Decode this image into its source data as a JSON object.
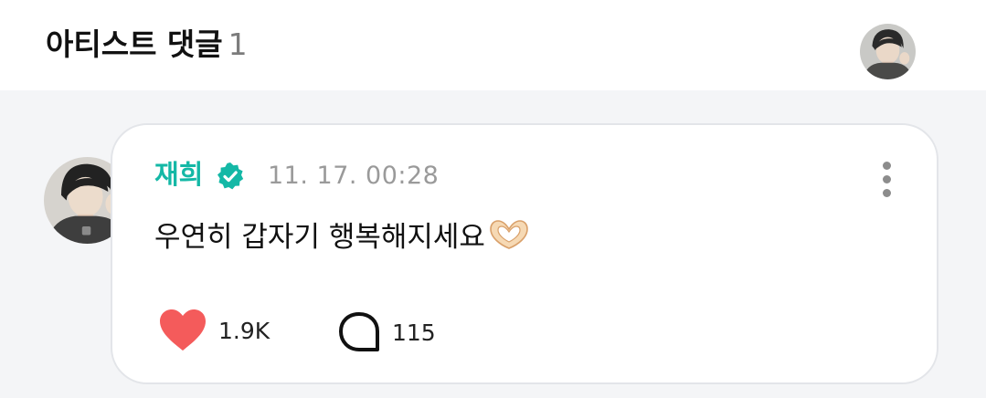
{
  "header": {
    "title": "아티스트 댓글",
    "count": "1",
    "avatar_icon": "user-avatar"
  },
  "comment": {
    "author": "재희",
    "verified_icon": "verified-badge-icon",
    "timestamp": "11. 17. 00:28",
    "body": "우연히 갑자기 행복해지세요",
    "emoji_icon": "heart-hands-icon",
    "likes": "1.9K",
    "replies": "115",
    "more_icon": "more-vertical-icon"
  },
  "colors": {
    "author": "#14b8a6",
    "heart": "#f45b5b",
    "background": "#f4f5f7",
    "card_border": "#e3e5e9"
  }
}
